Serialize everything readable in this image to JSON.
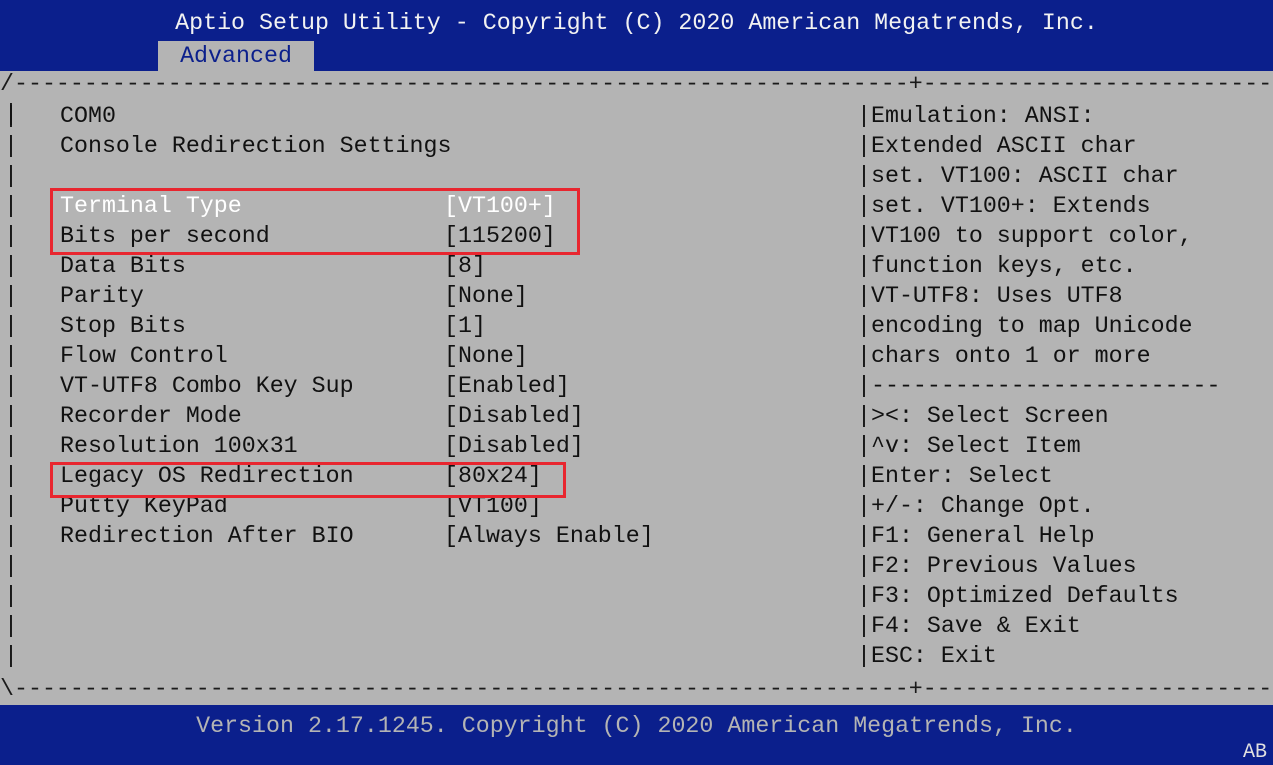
{
  "header": {
    "title": "Aptio Setup Utility - Copyright (C) 2020 American Megatrends, Inc.",
    "active_tab": "Advanced"
  },
  "frame": {
    "top_border": "/----------------------------------------------------------------+------------------------------",
    "bottom_border": "\\----------------------------------------------------------------+------------------------------,",
    "pipe": "|"
  },
  "left": {
    "section_title": "COM0",
    "section_subtitle": "Console Redirection Settings",
    "options": [
      {
        "label": "Terminal Type",
        "value": "[VT100+]"
      },
      {
        "label": "Bits per second",
        "value": "[115200]"
      },
      {
        "label": "Data Bits",
        "value": "[8]"
      },
      {
        "label": "Parity",
        "value": "[None]"
      },
      {
        "label": "Stop Bits",
        "value": "[1]"
      },
      {
        "label": "Flow Control",
        "value": "[None]"
      },
      {
        "label": "VT-UTF8 Combo Key Sup",
        "value": "[Enabled]"
      },
      {
        "label": "Recorder Mode",
        "value": "[Disabled]"
      },
      {
        "label": "Resolution 100x31",
        "value": "[Disabled]"
      },
      {
        "label": "Legacy OS Redirection",
        "value": "[80x24]"
      },
      {
        "label": "Putty KeyPad",
        "value": "[VT100]"
      },
      {
        "label": "Redirection After BIO",
        "value": "[Always Enable]"
      }
    ]
  },
  "help": {
    "lines": [
      "|Emulation: ANSI:",
      "|Extended ASCII char",
      "|set. VT100: ASCII char",
      "|set. VT100+: Extends",
      "|VT100 to support color,",
      "|function keys, etc.",
      "|VT-UTF8: Uses UTF8",
      "|encoding to map Unicode",
      "|chars onto 1 or more",
      "|-------------------------"
    ],
    "keys": [
      "|><: Select Screen",
      "|^v: Select Item",
      "|Enter: Select",
      "|+/-: Change Opt.",
      "|F1: General Help",
      "|F2: Previous Values",
      "|F3: Optimized Defaults",
      "|F4: Save & Exit",
      "|ESC: Exit"
    ]
  },
  "footer": {
    "version": "Version 2.17.1245. Copyright (C) 2020 American Megatrends, Inc.",
    "indicator": "AB"
  },
  "colors": {
    "header_bg": "#0b1f8c",
    "body_bg": "#b4b4b4",
    "highlight_box": "#e8262f",
    "selected_text": "#ffffff"
  }
}
